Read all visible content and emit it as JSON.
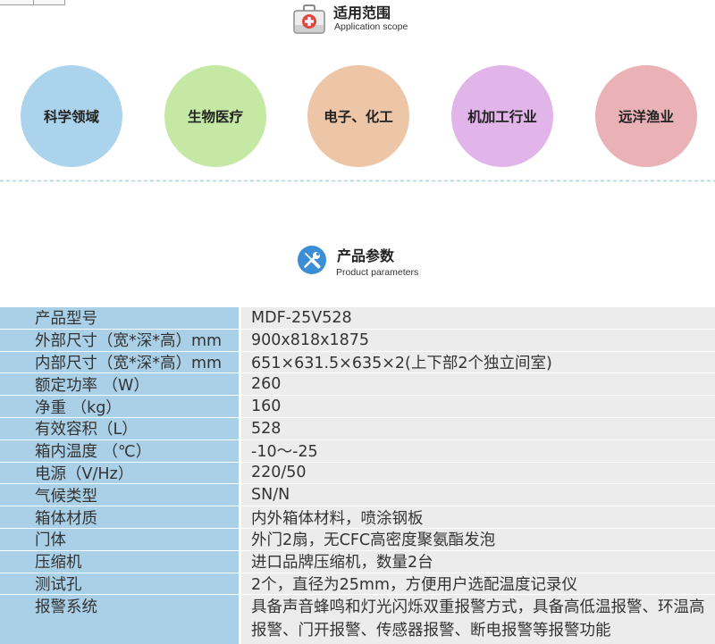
{
  "scope": {
    "title": "适用范围",
    "subtitle": "Application scope",
    "icon": "first-aid-kit-icon",
    "items": [
      {
        "label": "科学领域",
        "color": "#abd4ec"
      },
      {
        "label": "生物医疗",
        "color": "#c6e8a5"
      },
      {
        "label": "电子、化工",
        "color": "#edc6a8"
      },
      {
        "label": "机加工行业",
        "color": "#e1b5e9"
      },
      {
        "label": "远洋渔业",
        "color": "#eab1b6"
      }
    ]
  },
  "divider": {
    "color": "#a7d6dd"
  },
  "parameters": {
    "title": "产品参数",
    "subtitle": "Product parameters",
    "icon": "tools-icon",
    "icon_color": "#3a8ed5",
    "label_bg": "#a9d0e7",
    "value_bg": "#ececec",
    "rows": [
      {
        "label": "产品型号",
        "value": "MDF-25V528"
      },
      {
        "label": "外部尺寸（宽*深*高）mm",
        "value": "900x818x1875"
      },
      {
        "label": "内部尺寸（宽*深*高）mm",
        "value": "651×631.5×635×2(上下部2个独立间室)"
      },
      {
        "label": "额定功率 （W）",
        "value": "260"
      },
      {
        "label": "净重 （kg）",
        "value": "160"
      },
      {
        "label": "有效容积（L）",
        "value": "528"
      },
      {
        "label": "箱内温度 （℃）",
        "value": "-10～-25"
      },
      {
        "label": "电源（V/Hz）",
        "value": "220/50"
      },
      {
        "label": "气候类型",
        "value": "SN/N"
      },
      {
        "label": "箱体材质",
        "value": "内外箱体材料，喷涂钢板"
      },
      {
        "label": "门体",
        "value": "外门2扇，无CFC高密度聚氨酯发泡"
      },
      {
        "label": "压缩机",
        "value": "进口品牌压缩机，数量2台"
      },
      {
        "label": "测试孔",
        "value": "2个，直径为25mm，方便用户选配温度记录仪"
      },
      {
        "label": "报警系统",
        "value": "具备声音蜂鸣和灯光闪烁双重报警方式，具备高低温报警、环温高报警、门开报警、传感器报警、断电报警等报警功能"
      }
    ]
  }
}
